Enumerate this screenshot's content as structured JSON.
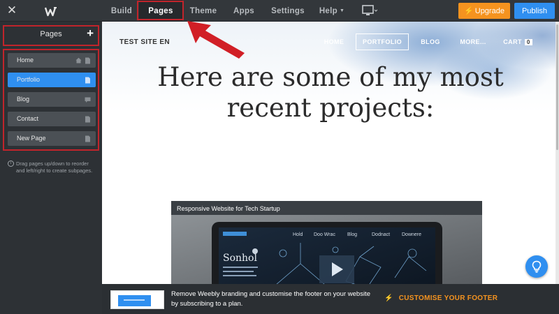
{
  "topbar": {
    "close_icon": "close-icon",
    "logo_icon": "weebly-logo-icon",
    "nav": [
      {
        "label": "Build",
        "active": false
      },
      {
        "label": "Pages",
        "active": true
      },
      {
        "label": "Theme",
        "active": false
      },
      {
        "label": "Apps",
        "active": false
      },
      {
        "label": "Settings",
        "active": false
      },
      {
        "label": "Help",
        "active": false
      }
    ],
    "device_icon": "desktop-icon",
    "upgrade_label": "Upgrade",
    "publish_label": "Publish",
    "colors": {
      "upgrade": "#f5931f",
      "publish": "#2f8ff0",
      "bar": "#33373b"
    }
  },
  "sidebar": {
    "title": "Pages",
    "add_icon": "plus-icon",
    "pages": [
      {
        "label": "Home",
        "icons": [
          "home-icon",
          "page-icon"
        ],
        "active": false
      },
      {
        "label": "Portfolio",
        "icons": [
          "page-icon"
        ],
        "active": true
      },
      {
        "label": "Blog",
        "icons": [
          "blog-icon"
        ],
        "active": false
      },
      {
        "label": "Contact",
        "icons": [
          "page-icon"
        ],
        "active": false
      },
      {
        "label": "New Page",
        "icons": [
          "page-icon"
        ],
        "active": false
      }
    ],
    "hint": "Drag pages up/down to reorder and left/right to create subpages."
  },
  "site": {
    "name": "TEST SITE EN",
    "nav": [
      "HOME",
      "PORTFOLIO",
      "BLOG",
      "MORE...",
      "CART"
    ],
    "cart_count": "0",
    "hero_title": "Here are some of my most recent projects:",
    "project_caption": "Responsive Website for Tech Startup",
    "project_screen_brand": "Sonhol",
    "project_screen_menu": [
      "Hold",
      "Doo Wrac",
      "Blog",
      "Dodnact",
      "Downere"
    ],
    "help_icon": "lightbulb-icon"
  },
  "footer": {
    "text": "Remove Weebly branding and customise the footer on your website by subscribing to a plan.",
    "cta": "CUSTOMISE YOUR FOOTER",
    "cta_icon": "bolt-icon"
  }
}
